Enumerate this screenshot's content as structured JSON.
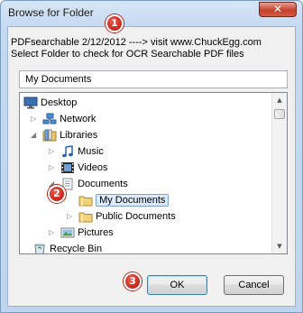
{
  "window": {
    "title": "Browse for Folder",
    "close_label": "✕"
  },
  "description": {
    "line1": "PDFsearchable 2/12/2012 ---->  visit www.ChuckEgg.com",
    "line2": "Select Folder to check for OCR Searchable PDF files"
  },
  "folder_field": {
    "value": "My Documents"
  },
  "tree": {
    "items": [
      {
        "label": "Desktop",
        "icon": "desktop-icon",
        "expander": "",
        "selected": false
      },
      {
        "label": "Network",
        "icon": "network-icon",
        "expander": "▷",
        "selected": false
      },
      {
        "label": "Libraries",
        "icon": "libraries-icon",
        "expander": "◢",
        "selected": false
      },
      {
        "label": "Music",
        "icon": "music-icon",
        "expander": "▷",
        "selected": false
      },
      {
        "label": "Videos",
        "icon": "videos-icon",
        "expander": "▷",
        "selected": false
      },
      {
        "label": "Documents",
        "icon": "documents-icon",
        "expander": "◢",
        "selected": false
      },
      {
        "label": "My Documents",
        "icon": "folder-icon",
        "expander": "",
        "selected": true
      },
      {
        "label": "Public Documents",
        "icon": "folder-icon",
        "expander": "▷",
        "selected": false
      },
      {
        "label": "Pictures",
        "icon": "pictures-icon",
        "expander": "▷",
        "selected": false
      },
      {
        "label": "Recycle Bin",
        "icon": "recycle-bin-icon",
        "expander": "",
        "selected": false
      }
    ]
  },
  "buttons": {
    "ok": "OK",
    "cancel": "Cancel"
  },
  "markers": [
    "1",
    "2",
    "3"
  ],
  "colors": {
    "marker": "#d2362a",
    "selection": "#dcebfc",
    "titlebar": "#c5d9f1"
  }
}
